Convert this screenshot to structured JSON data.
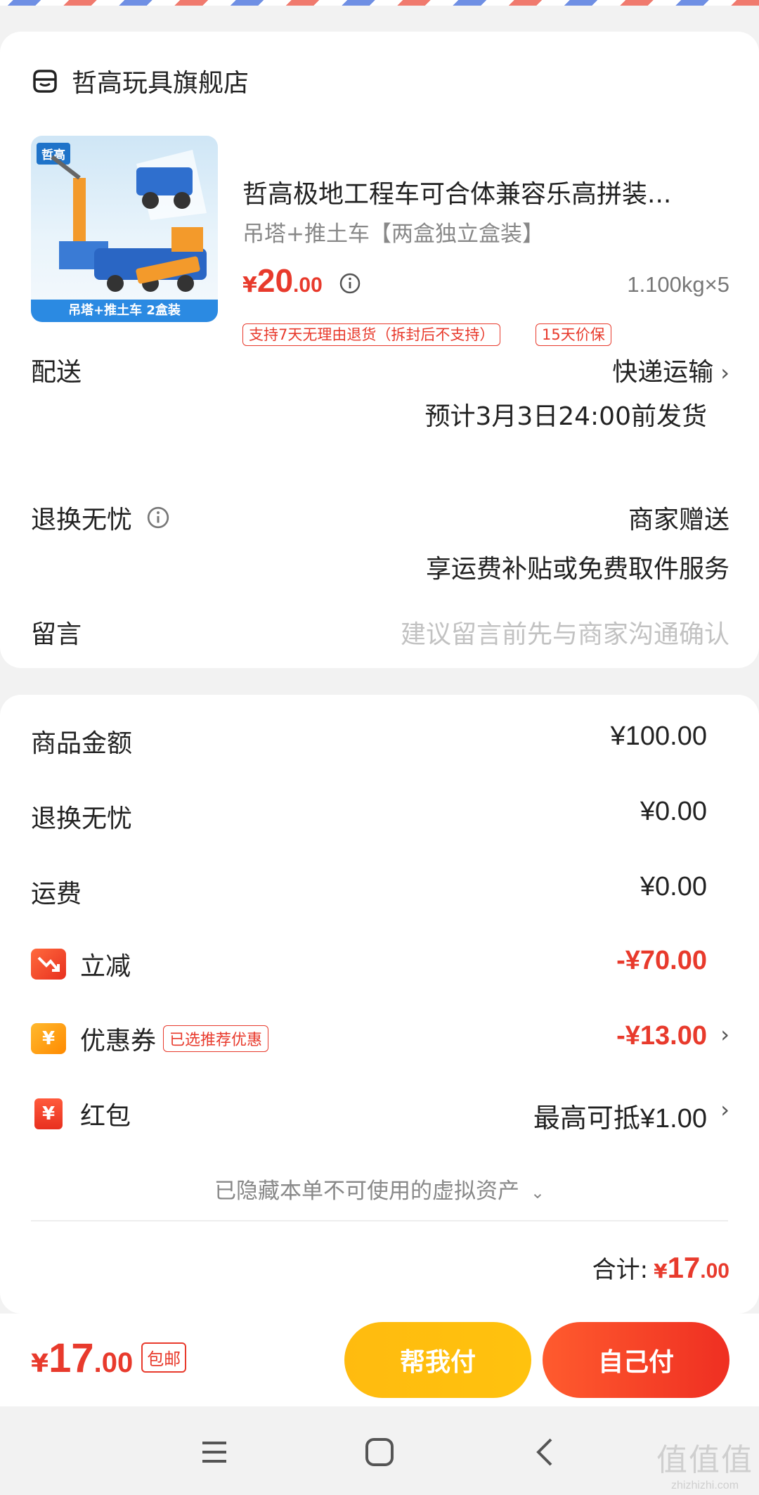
{
  "shop": {
    "name": "哲高玩具旗舰店",
    "icon": "shop-icon"
  },
  "product": {
    "thumbnail": {
      "brand": "哲高",
      "caption": "吊塔+推土车 2盒装"
    },
    "title": "哲高极地工程车可合体兼容乐高拼装...",
    "spec": "吊塔+推土车【两盒独立盒装】",
    "price": {
      "symbol": "¥",
      "integer": "20",
      "decimal": ".00"
    },
    "quantity": "1.100kg×5",
    "tags": [
      "支持7天无理由退货（拆封后不支持）",
      "15天价保"
    ]
  },
  "delivery": {
    "label": "配送",
    "method": "快递运输",
    "eta": "预计3月3日24:00前发货"
  },
  "return": {
    "label": "退换无忧",
    "value": "商家赠送",
    "desc": "享运费补贴或免费取件服务"
  },
  "message": {
    "label": "留言",
    "placeholder": "建议留言前先与商家沟通确认"
  },
  "fees": {
    "goods": {
      "label": "商品金额",
      "value": "¥100.00"
    },
    "return": {
      "label": "退换无忧",
      "value": "¥0.00"
    },
    "shipping": {
      "label": "运费",
      "value": "¥0.00"
    },
    "discount": {
      "label": "立减",
      "value": "-¥70.00"
    },
    "coupon": {
      "label": "优惠券",
      "tag": "已选推荐优惠",
      "value": "-¥13.00",
      "icon_text": "¥"
    },
    "redpacket": {
      "label": "红包",
      "value": "最高可抵¥1.00",
      "icon_text": "¥"
    }
  },
  "hidden_assets": "已隐藏本单不可使用的虚拟资产",
  "total": {
    "label": "合计:",
    "symbol": "¥",
    "integer": "17",
    "decimal": ".00"
  },
  "bottom": {
    "price": {
      "symbol": "¥",
      "integer": "17",
      "decimal": ".00"
    },
    "free_shipping": "包邮",
    "help_pay": "帮我付",
    "self_pay": "自己付"
  },
  "watermark": {
    "big": "值值值",
    "small": "zhizhizhi.com"
  },
  "colors": {
    "accent": "#e83a2c",
    "yellow": "#ffbb0f",
    "background": "#f2f2f2"
  }
}
